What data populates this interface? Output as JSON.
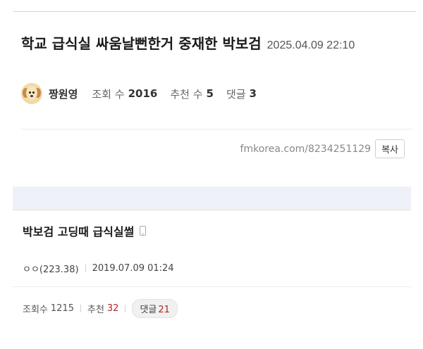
{
  "post": {
    "title": "학교 급식실 싸움날뻔한거 중재한 박보검",
    "date": "2025.04.09 22:10",
    "author": "짱원영",
    "views_label": "조회 수",
    "views": "2016",
    "recommend_label": "추천 수",
    "recommend": "5",
    "comments_label": "댓글",
    "comments": "3",
    "url": "fmkorea.com/8234251129",
    "copy_label": "복사"
  },
  "embedded": {
    "title": "박보검 고딩때 급식실썰",
    "author": "ㅇㅇ(223.38)",
    "date": "2019.07.09 01:24",
    "views_label": "조회수",
    "views": "1215",
    "recommend_label": "추천",
    "recommend": "32",
    "comments_label": "댓글",
    "comments": "21"
  },
  "colors": {
    "accent_red": "#b32424",
    "band": "#eef2f8"
  },
  "icons": {
    "avatar": "puppy-avatar-icon",
    "device": "mobile-phone-icon"
  }
}
